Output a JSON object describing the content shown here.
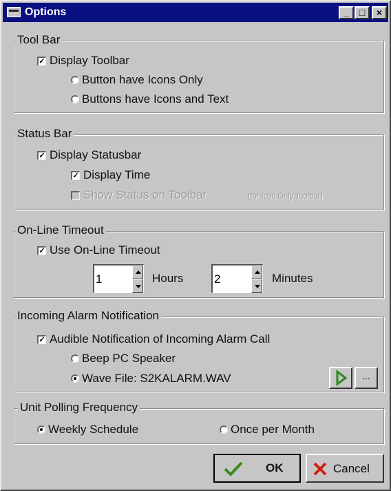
{
  "window": {
    "title": "Options",
    "minimize_glyph": "_",
    "maximize_glyph": "□",
    "close_glyph": "×"
  },
  "toolbar_group": {
    "legend": "Tool Bar",
    "display_toolbar": {
      "label": "Display Toolbar",
      "checked": true
    },
    "icons_only": {
      "label": "Button have Icons Only",
      "selected": false
    },
    "icons_text": {
      "label": "Buttons have Icons and Text",
      "selected": false
    }
  },
  "statusbar_group": {
    "legend": "Status Bar",
    "display_statusbar": {
      "label": "Display Statusbar",
      "checked": true
    },
    "display_time": {
      "label": "Display Time",
      "checked": true
    },
    "show_status_on_toolbar": {
      "label": "Show Status on Toolbar",
      "checked": false,
      "enabled": false
    },
    "note": "(for Icon Only Toolbar)"
  },
  "timeout_group": {
    "legend": "On-Line Timeout",
    "use_timeout": {
      "label": "Use On-Line Timeout",
      "checked": true
    },
    "hours_value": "1",
    "hours_label": "Hours",
    "minutes_value": "2",
    "minutes_label": "Minutes"
  },
  "alarm_group": {
    "legend": "Incoming Alarm Notification",
    "audible": {
      "label": "Audible Notification of Incoming Alarm Call",
      "checked": true
    },
    "beep": {
      "label": "Beep PC Speaker",
      "selected": false
    },
    "wave": {
      "label": "Wave File:  S2KALARM.WAV",
      "selected": true
    },
    "browse_label": "..."
  },
  "polling_group": {
    "legend": "Unit Polling Frequency",
    "weekly": {
      "label": "Weekly Schedule",
      "selected": true
    },
    "monthly": {
      "label": "Once per Month",
      "selected": false
    }
  },
  "buttons": {
    "ok": "OK",
    "cancel": "Cancel"
  },
  "icons": {
    "ok_icon": "check-icon",
    "cancel_icon": "x-icon",
    "play_icon": "play-icon"
  },
  "colors": {
    "titlebar": "#0a1080",
    "face": "#c6c6c6",
    "ok_check": "#3a8a1c",
    "cancel_x": "#d02010",
    "play": "#2e8b1e"
  }
}
